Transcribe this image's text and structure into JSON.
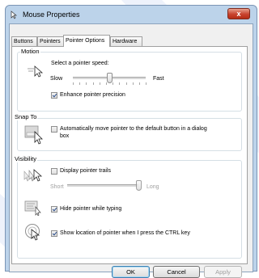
{
  "window": {
    "title": "Mouse Properties",
    "close_glyph": "x"
  },
  "tabs": [
    {
      "label": "Buttons"
    },
    {
      "label": "Pointers"
    },
    {
      "label": "Pointer Options"
    },
    {
      "label": "Hardware"
    }
  ],
  "motion": {
    "group_label": "Motion",
    "speed_prompt": "Select a pointer speed:",
    "slow_label": "Slow",
    "fast_label": "Fast",
    "speed_level": 0.5,
    "precision_label": "Enhance pointer precision",
    "precision_checked": true
  },
  "snap": {
    "group_label": "Snap To",
    "auto_label_line1": "Automatically move pointer to the default button in a dialog",
    "auto_label_line2": "box",
    "auto_checked": false
  },
  "visibility": {
    "group_label": "Visibility",
    "trails_label": "Display pointer trails",
    "trails_checked": false,
    "short_label": "Short",
    "long_label": "Long",
    "trails_level": 1.0,
    "hide_label": "Hide pointer while typing",
    "hide_checked": true,
    "ctrl_label": "Show location of pointer when I press the CTRL key",
    "ctrl_checked": true
  },
  "buttons": {
    "ok": "OK",
    "cancel": "Cancel",
    "apply": "Apply"
  }
}
